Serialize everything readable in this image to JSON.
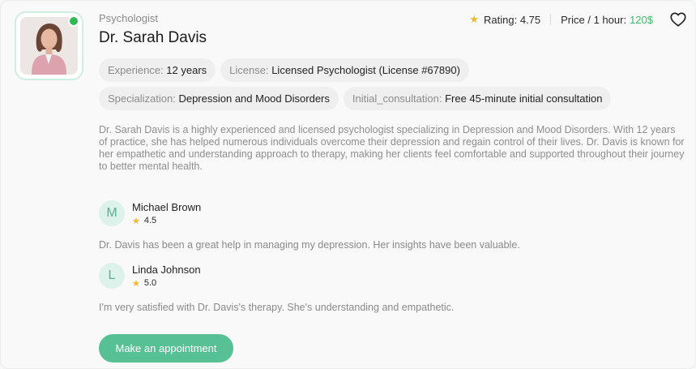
{
  "profile": {
    "profession": "Psychologist",
    "name": "Dr. Sarah Davis",
    "rating_label": "Rating:",
    "rating_value": "4.75",
    "price_label": "Price / 1 hour:",
    "price_value": "120$",
    "online": true,
    "icons": {
      "favorite": "heart-icon",
      "rating": "star-icon"
    }
  },
  "details": [
    {
      "key": "Experience:",
      "value": "12 years"
    },
    {
      "key": "License:",
      "value": "Licensed Psychologist (License #67890)"
    },
    {
      "key": "Specialization:",
      "value": "Depression and Mood Disorders"
    },
    {
      "key": "Initial_consultation:",
      "value": "Free 45-minute initial consultation"
    }
  ],
  "bio": "Dr. Sarah Davis is a highly experienced and licensed psychologist specializing in Depression and Mood Disorders. With 12 years of practice, she has helped numerous individuals overcome their depression and regain control of their lives. Dr. Davis is known for her empathetic and understanding approach to therapy, making her clients feel comfortable and supported throughout their journey to better mental health.",
  "reviews": [
    {
      "initial": "M",
      "name": "Michael Brown",
      "rating": "4.5",
      "text": "Dr. Davis has been a great help in managing my depression. Her insights have been valuable."
    },
    {
      "initial": "L",
      "name": "Linda Johnson",
      "rating": "5.0",
      "text": "I'm very satisfied with Dr. Davis's therapy. She's understanding and empathetic."
    }
  ],
  "cta_label": "Make an appointment",
  "colors": {
    "accent": "#58c095",
    "price": "#3fbe6a",
    "star": "#f2b829",
    "online": "#2fbb53"
  }
}
